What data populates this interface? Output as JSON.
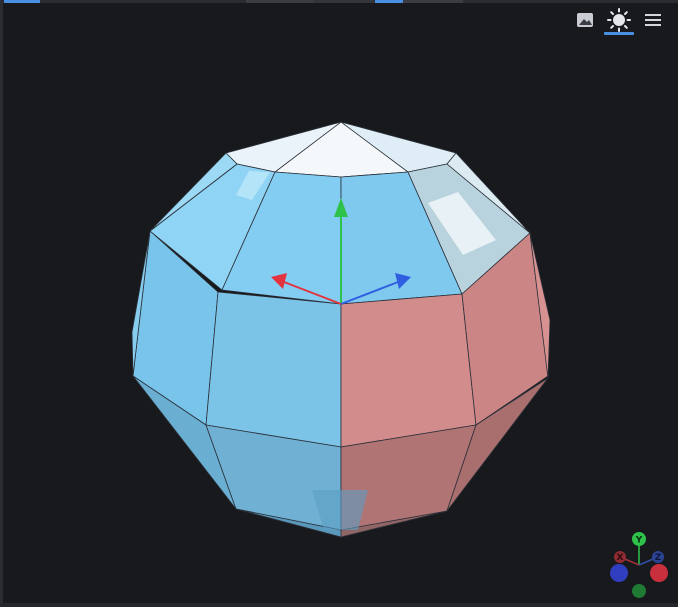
{
  "toolbar": {
    "buttons": [
      {
        "name": "image-icon",
        "active": false
      },
      {
        "name": "sun-icon",
        "active": true
      },
      {
        "name": "menu-icon",
        "active": false
      }
    ]
  },
  "gizmo": {
    "y_label": "Y",
    "x_label": "X",
    "z_label": "Z"
  },
  "colors": {
    "background": "#18191d",
    "accent": "#4a90e2",
    "x_axis": "#e2333f",
    "y_axis": "#2ec24a",
    "z_axis": "#2f5fe0",
    "cool_face": "#7fc8ef",
    "warm_face": "#d38c8c"
  }
}
